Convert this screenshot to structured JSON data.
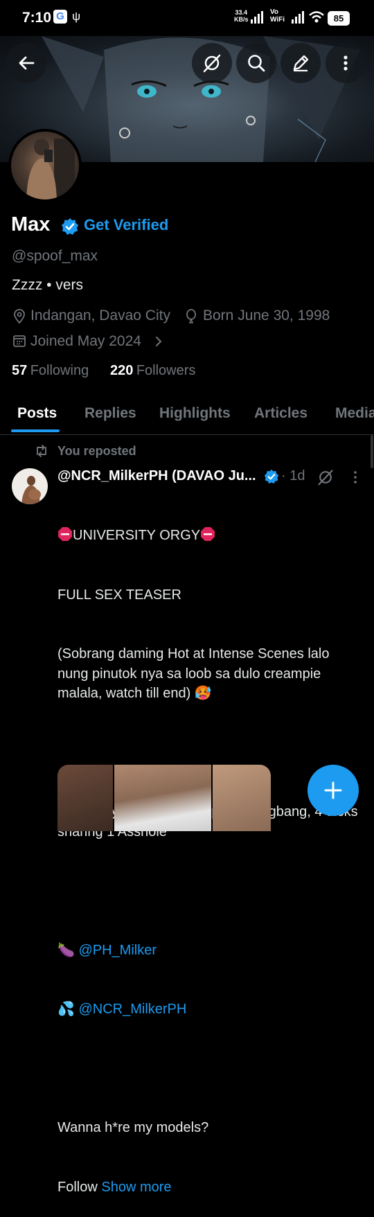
{
  "status_bar": {
    "time": "7:10",
    "google_badge": "G",
    "net_speed_value": "33.4",
    "net_speed_unit": "KB/s",
    "vo_label": "Vo",
    "wifi_label": "WiFi",
    "battery": "85"
  },
  "header": {
    "icons": [
      "back-arrow-icon",
      "grok-icon",
      "search-icon",
      "edit-icon",
      "more-vertical-icon"
    ]
  },
  "profile": {
    "display_name": "Max",
    "get_verified": "Get Verified",
    "handle": "@spoof_max",
    "bio": "Zzzz • vers",
    "location": "Indangan, Davao City",
    "birthday": "Born June 30, 1998",
    "joined": "Joined May 2024",
    "following_count": "57",
    "following_label": "Following",
    "followers_count": "220",
    "followers_label": "Followers"
  },
  "tabs": [
    {
      "label": "Posts",
      "active": true
    },
    {
      "label": "Replies",
      "active": false
    },
    {
      "label": "Highlights",
      "active": false
    },
    {
      "label": "Articles",
      "active": false
    },
    {
      "label": "Media",
      "active": false
    }
  ],
  "post": {
    "repost_label": "You reposted",
    "author": "@NCR_MilkerPH (DAVAO Ju...",
    "time": "· 1d",
    "line1": "UNIVERSITY ORGY",
    "line2": "FULL SEX TEASER",
    "line3": "(Sobrang daming Hot at Intense Scenes lalo nung pinutok nya sa loob sa dulo creampie malala, watch till end)",
    "emoji_hot": "🥵",
    "line4": "University Students Groupfun Gangbang, 4 dicks sharing 1 Asshole",
    "emoji_eggplant": "🍆",
    "mention1": "@PH_Milker",
    "emoji_drops": "💦",
    "mention2": "@NCR_MilkerPH",
    "line5": "Wanna h*re my models?",
    "line6": "Follow",
    "show_more": "Show more"
  },
  "colors": {
    "accent": "#1d9bf0",
    "background": "#000000",
    "secondary_text": "#71767b",
    "stop_sign": "#e0245e"
  }
}
